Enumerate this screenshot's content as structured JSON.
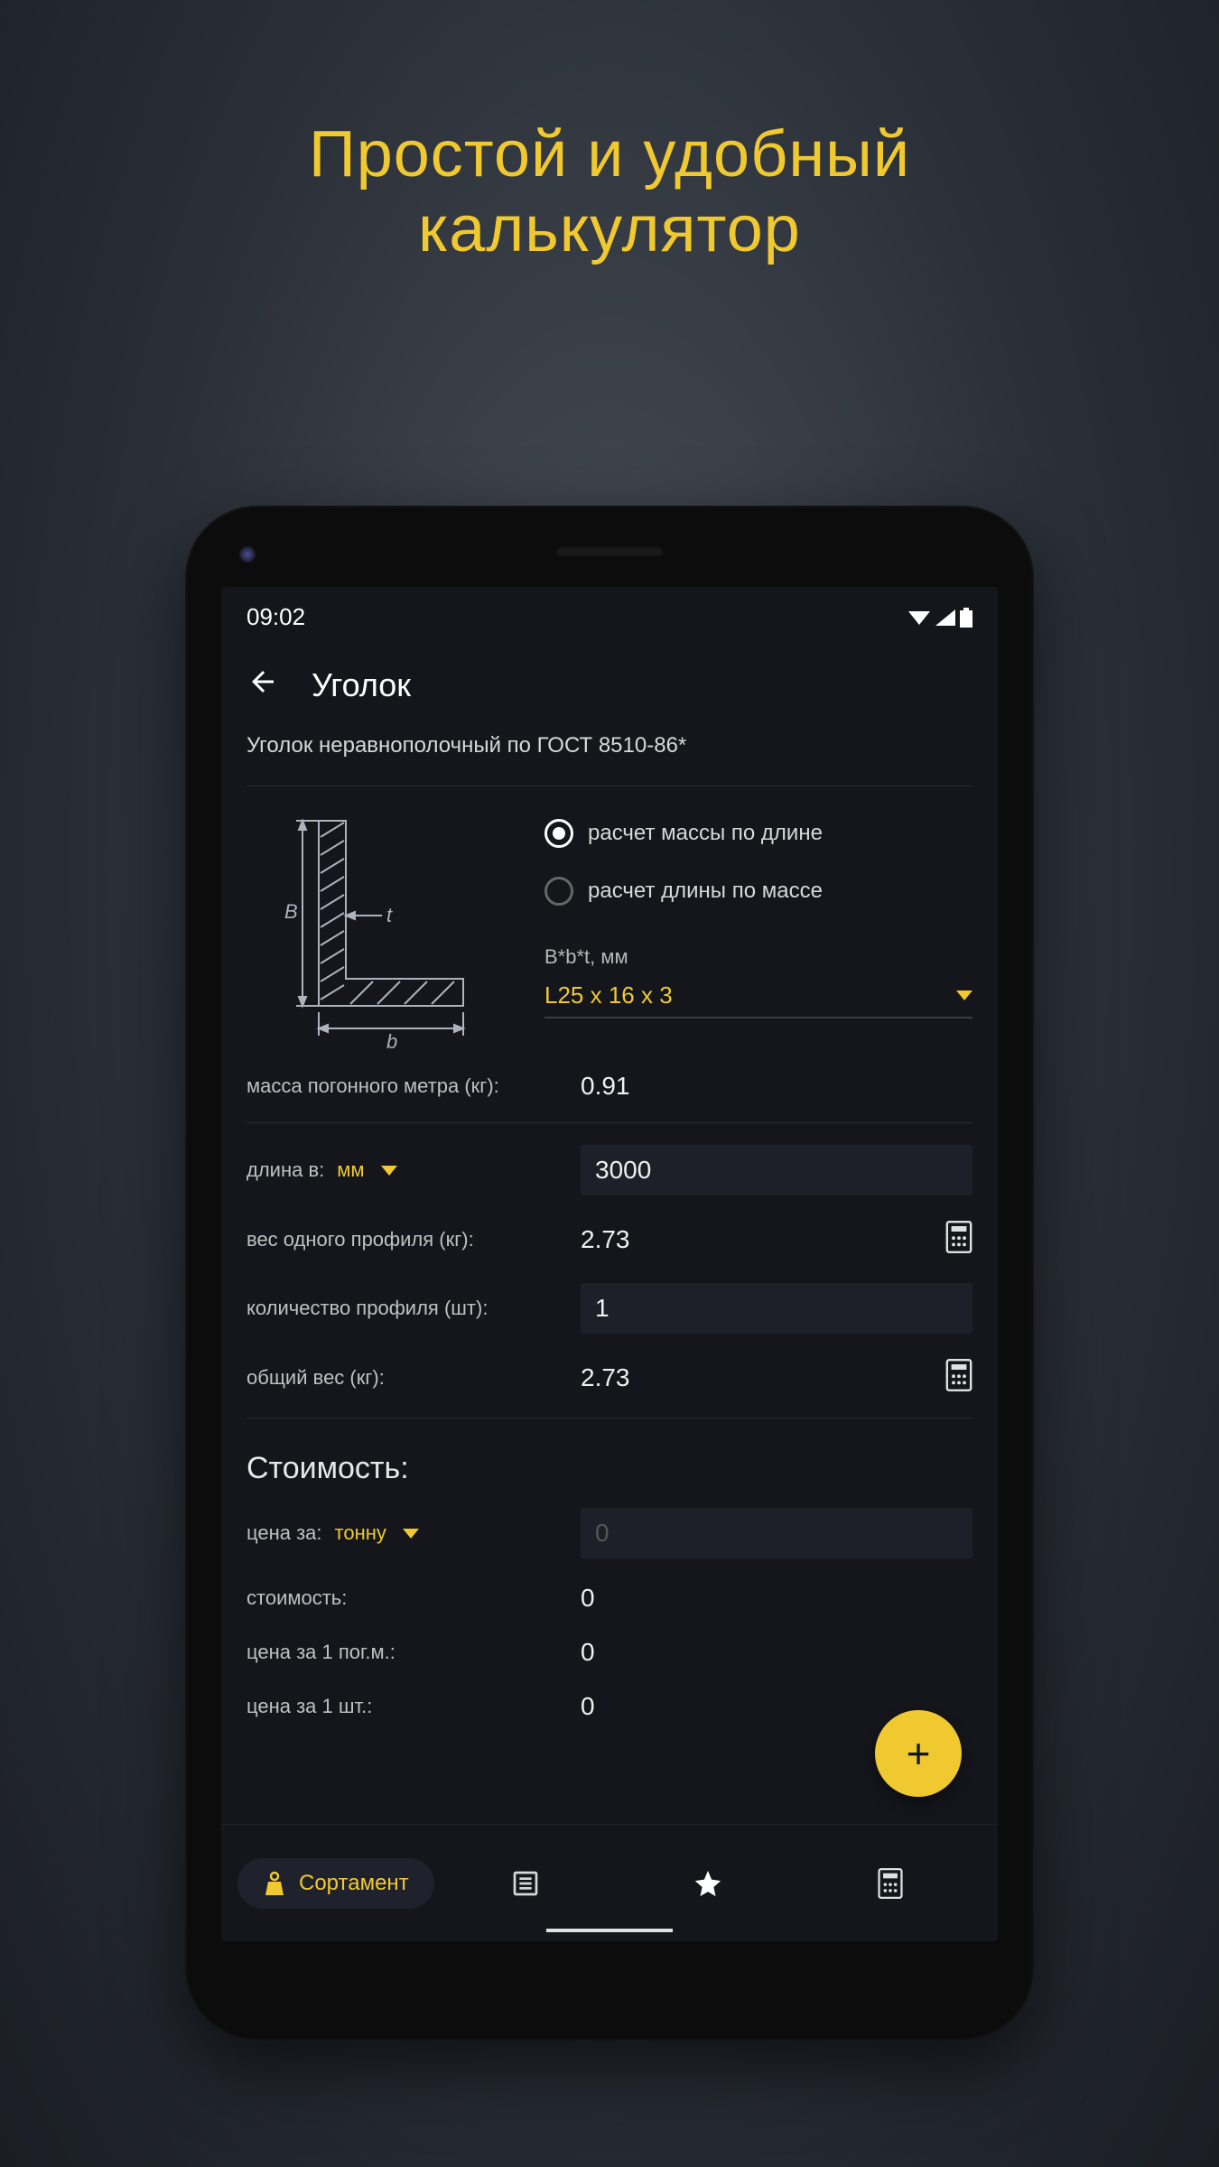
{
  "promo": {
    "line1": "Простой и удобный",
    "line2": "калькулятор"
  },
  "status": {
    "time": "09:02"
  },
  "header": {
    "title": "Уголок"
  },
  "subtitle": "Уголок неравнополочный по ГОСТ 8510-86*",
  "radios": {
    "by_length": "расчет массы по длине",
    "by_mass": "расчет длины по массе"
  },
  "size_selector": {
    "label": "B*b*t, мм",
    "value": "L25 x 16 x 3"
  },
  "diagram": {
    "B_label": "B",
    "b_label": "b",
    "t_label": "t"
  },
  "fields": {
    "mass_per_meter_label": "масса погонного метра (кг):",
    "mass_per_meter_value": "0.91",
    "length_label": "длина в:",
    "length_unit": "мм",
    "length_value": "3000",
    "single_weight_label": "вес одного профиля (кг):",
    "single_weight_value": "2.73",
    "qty_label": "количество профиля (шт):",
    "qty_value": "1",
    "total_weight_label": "общий вес (кг):",
    "total_weight_value": "2.73"
  },
  "cost": {
    "section_title": "Стоимость:",
    "price_per_label": "цена за:",
    "price_per_unit": "тонну",
    "price_placeholder": "0",
    "cost_label": "стоимость:",
    "cost_value": "0",
    "per_pogm_label": "цена за 1 пог.м.:",
    "per_pogm_value": "0",
    "per_piece_label": "цена за 1 шт.:",
    "per_piece_value": "0"
  },
  "nav": {
    "sortament": "Сортамент"
  },
  "fab": {
    "label": "+"
  }
}
